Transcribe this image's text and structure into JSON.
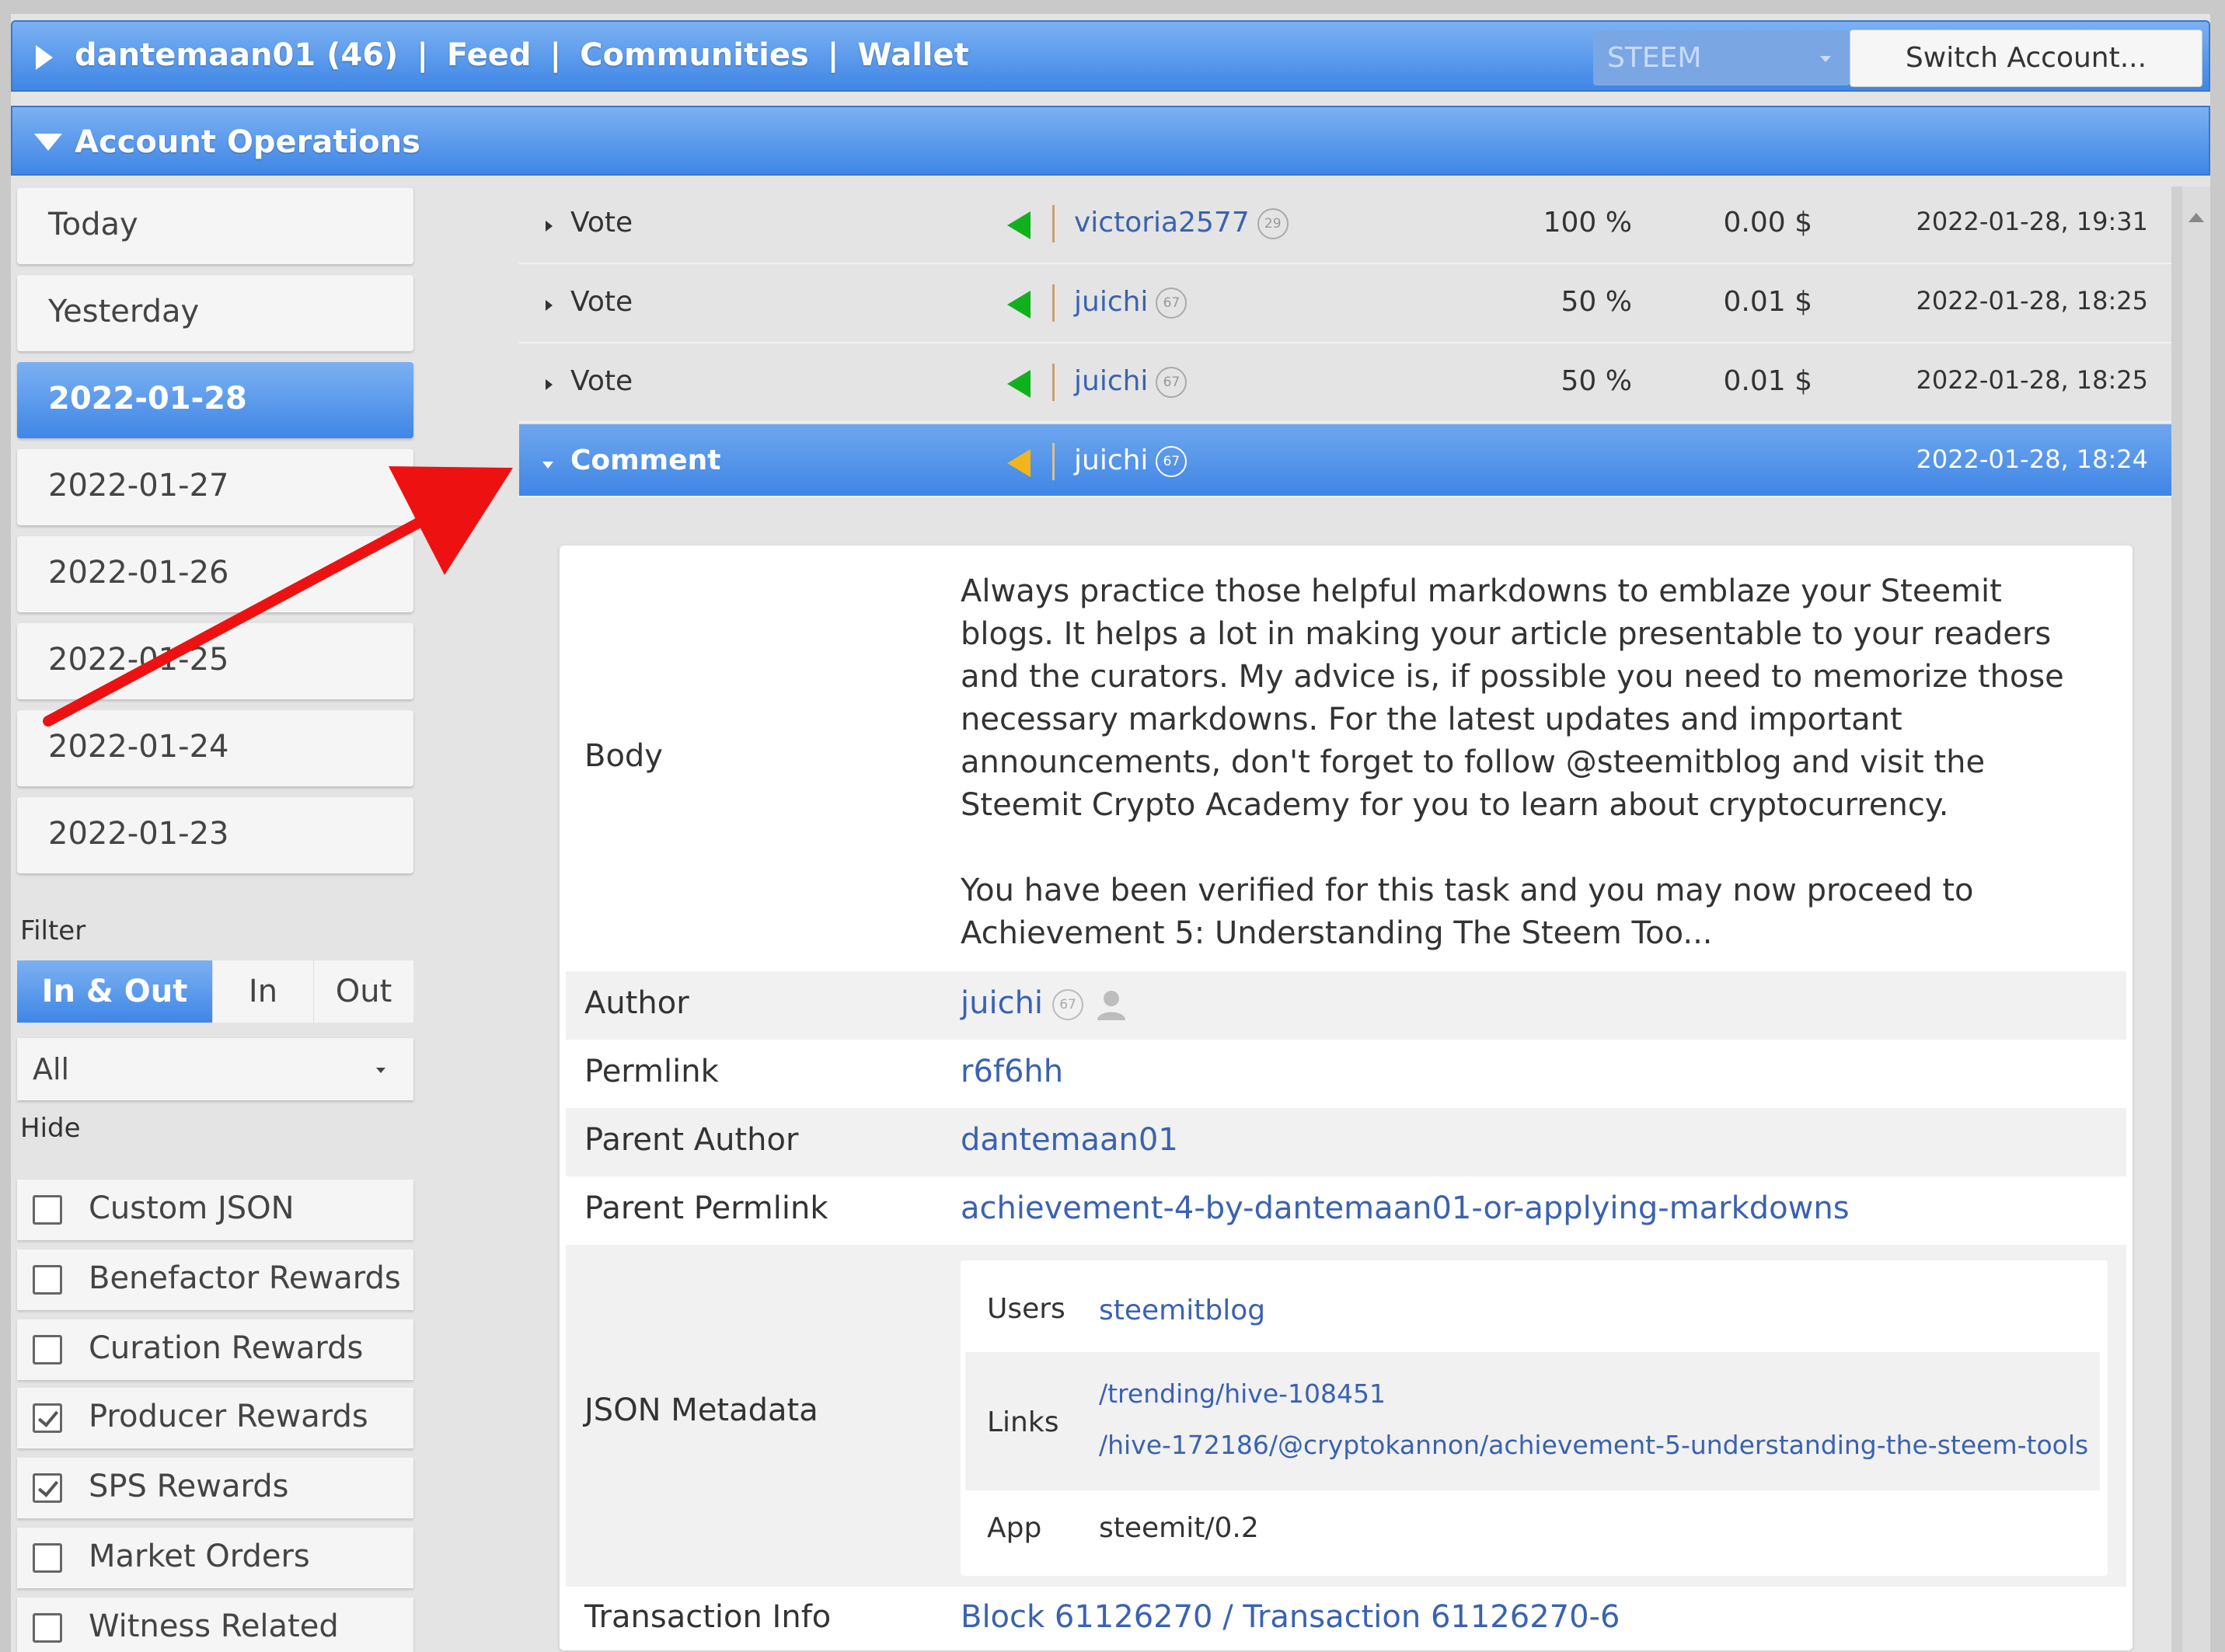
{
  "topbar": {
    "account": "dantemaan01 (46)",
    "nav": [
      "Feed",
      "Communities",
      "Wallet"
    ],
    "separator": "|",
    "chain_select": "STEEM",
    "switch_account": "Switch Account..."
  },
  "section": {
    "title": "Account Operations"
  },
  "sidebar": {
    "days": [
      "Today",
      "Yesterday",
      "2022-01-28",
      "2022-01-27",
      "2022-01-26",
      "2022-01-25",
      "2022-01-24",
      "2022-01-23"
    ],
    "active_day": "2022-01-28",
    "filter_label": "Filter",
    "filter_options": [
      "In & Out",
      "In",
      "Out"
    ],
    "filter_select": "All",
    "hide_label": "Hide",
    "hide_items": [
      {
        "label": "Custom JSON",
        "checked": false
      },
      {
        "label": "Benefactor Rewards",
        "checked": false
      },
      {
        "label": "Curation Rewards",
        "checked": false
      },
      {
        "label": "Producer Rewards",
        "checked": true
      },
      {
        "label": "SPS Rewards",
        "checked": true
      },
      {
        "label": "Market Orders",
        "checked": false
      },
      {
        "label": "Witness Related",
        "checked": false
      }
    ]
  },
  "operations": [
    {
      "type": "Vote",
      "user": "victoria2577",
      "rep": "29",
      "pct": "100 %",
      "usd": "0.00 $",
      "time": "2022-01-28, 19:31"
    },
    {
      "type": "Vote",
      "user": "juichi",
      "rep": "67",
      "pct": "50 %",
      "usd": "0.01 $",
      "time": "2022-01-28, 18:25"
    },
    {
      "type": "Vote",
      "user": "juichi",
      "rep": "67",
      "pct": "50 %",
      "usd": "0.01 $",
      "time": "2022-01-28, 18:25"
    },
    {
      "type": "Comment",
      "user": "juichi",
      "rep": "67",
      "time": "2022-01-28, 18:24"
    }
  ],
  "detail": {
    "body_label": "Body",
    "body_p1": "Always practice those helpful markdowns to emblaze your Steemit blogs. It helps a lot in making your article presentable to your readers and the curators. My advice is, if possible you need to memorize those necessary markdowns. For the latest updates and important announcements, don't forget to follow @steemitblog and visit the Steemit Crypto Academy for you to learn about cryptocurrency.",
    "body_p2": "You have been verified for this task and you may now proceed to Achievement 5: Understanding The Steem Too...",
    "author_label": "Author",
    "author": "juichi",
    "author_rep": "67",
    "permlink_label": "Permlink",
    "permlink": "r6f6hh",
    "parent_author_label": "Parent Author",
    "parent_author": "dantemaan01",
    "parent_permlink_label": "Parent Permlink",
    "parent_permlink": "achievement-4-by-dantemaan01-or-applying-markdowns",
    "json_label": "JSON Metadata",
    "json": {
      "users_label": "Users",
      "users": "steemitblog",
      "links_label": "Links",
      "link1": "/trending/hive-108451",
      "link2": "/hive-172186/@cryptokannon/achievement-5-understanding-the-steem-tools",
      "app_label": "App",
      "app": "steemit/0.2"
    },
    "tx_label": "Transaction Info",
    "block": "Block 61126270",
    "tx_sep": " / ",
    "transaction": "Transaction 61126270-6"
  },
  "colors": {
    "header_blue": "#3f86e6",
    "link_blue": "#3a62b0",
    "vote_green": "#11b01f",
    "comment_orange": "#f2b61c",
    "annotation_red": "#ee1111"
  },
  "icons": [
    "play-icon",
    "caret-down-icon",
    "direction-in-icon",
    "direction-out-icon",
    "reputation-badge",
    "user-icon",
    "checkbox-icon",
    "annotation-arrow"
  ]
}
